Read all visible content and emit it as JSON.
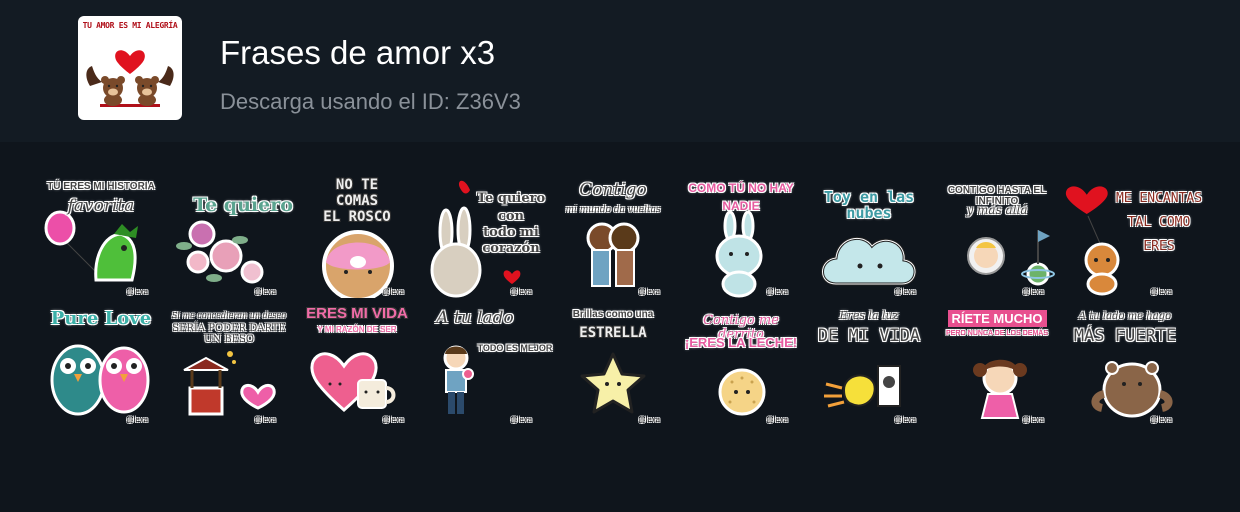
{
  "pack": {
    "title": "Frases de amor x3",
    "subtitle": "Descarga usando el ID: Z36V3",
    "icon_caption": "TU AMOR ES MI ALEGRÍA",
    "icon_name": "bears-with-heart-icon"
  },
  "watermark": "@lexa",
  "stickers": [
    {
      "lines": [
        "TÚ ERES MI HISTORIA",
        "favorita"
      ],
      "art": "dragon-with-balloon"
    },
    {
      "lines": [
        "Te quiero"
      ],
      "art": "roses"
    },
    {
      "lines": [
        "NO TE",
        "COMAS",
        "EL ROSCO"
      ],
      "art": "donut"
    },
    {
      "lines": [
        "Te quiero",
        "con",
        "todo mi",
        "corazón"
      ],
      "art": "bunny-with-hearts"
    },
    {
      "lines": [
        "Contigo",
        "mi mundo da vueltas"
      ],
      "art": "kissing-couple"
    },
    {
      "lines": [
        "COMO TÚ NO HAY",
        "NADIE"
      ],
      "art": "bunny"
    },
    {
      "lines": [
        "Toy en las nubes"
      ],
      "art": "cloud"
    },
    {
      "lines": [
        "CONTIGO HASTA EL INFINITO",
        "y más allá"
      ],
      "art": "astronaut"
    },
    {
      "lines": [
        "ME ENCANTAS",
        "TAL COMO",
        "ERES"
      ],
      "art": "fox-with-balloon"
    },
    {
      "lines": [
        "Pure Love"
      ],
      "art": "owls"
    },
    {
      "lines": [
        "Si me concedieran un deseo",
        "SERÍA PODER DARTE UN BESO"
      ],
      "art": "wishing-well"
    },
    {
      "lines": [
        "ERES MI VIDA",
        "Y MI RAZÓN DE SER"
      ],
      "art": "cup-and-heart"
    },
    {
      "lines": [
        "A tu lado",
        "TODO ES MEJOR"
      ],
      "art": "boy-with-flowers"
    },
    {
      "lines": [
        "Brillas como una",
        "ESTRELLA"
      ],
      "art": "star"
    },
    {
      "lines": [
        "Contigo me derrito",
        "¡ERES LA LECHE!"
      ],
      "art": "cookie"
    },
    {
      "lines": [
        "Eres la luz",
        "DE MI VIDA"
      ],
      "art": "lightbulb-character"
    },
    {
      "lines": [
        "RÍETE MUCHO",
        "PERO NUNCA DE LOS DEMÁS"
      ],
      "art": "laughing-girl"
    },
    {
      "lines": [
        "A tu lado me hago",
        "MÁS FUERTE"
      ],
      "art": "bear"
    }
  ]
}
